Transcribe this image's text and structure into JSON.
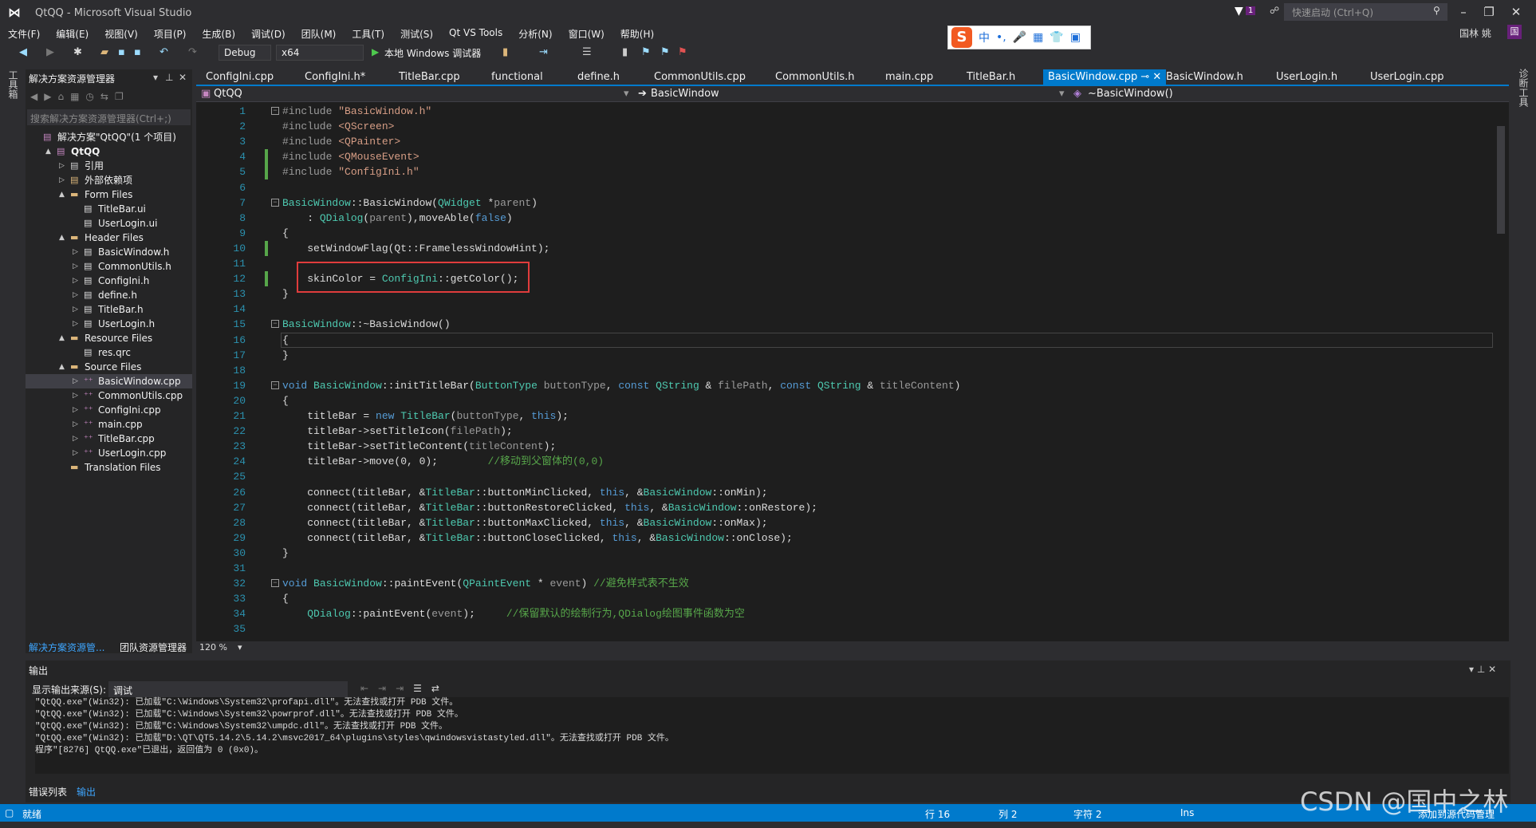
{
  "window": {
    "title": "QtQQ - Microsoft Visual Studio",
    "quick_launch": "快速启动 (Ctrl+Q)",
    "notif_count": "1",
    "user": "国林 姚",
    "avatar": "国"
  },
  "menu": [
    "文件(F)",
    "编辑(E)",
    "视图(V)",
    "项目(P)",
    "生成(B)",
    "调试(D)",
    "团队(M)",
    "工具(T)",
    "测试(S)",
    "Qt VS Tools",
    "分析(N)",
    "窗口(W)",
    "帮助(H)"
  ],
  "toolbar": {
    "config": "Debug",
    "platform": "x64",
    "run": "本地 Windows 调试器"
  },
  "ime": {
    "items": [
      "中",
      "•,",
      "🎤",
      "▦",
      "👕",
      "▣"
    ]
  },
  "left_strip": "工具箱",
  "right_strip": "诊断工具",
  "solution_explorer": {
    "title": "解决方案资源管理器",
    "search_placeholder": "搜索解决方案资源管理器(Ctrl+;)",
    "items": [
      {
        "label": "解决方案\"QtQQ\"(1 个项目)",
        "level": 0,
        "arrow": "",
        "icon": "solution"
      },
      {
        "label": "QtQQ",
        "level": 1,
        "arrow": "▲",
        "icon": "project",
        "bold": true
      },
      {
        "label": "引用",
        "level": 2,
        "arrow": "▷",
        "icon": "references"
      },
      {
        "label": "外部依赖项",
        "level": 2,
        "arrow": "▷",
        "icon": "dependencies"
      },
      {
        "label": "Form Files",
        "level": 2,
        "arrow": "▲",
        "icon": "folder"
      },
      {
        "label": "TitleBar.ui",
        "level": 3,
        "arrow": "",
        "icon": "file"
      },
      {
        "label": "UserLogin.ui",
        "level": 3,
        "arrow": "",
        "icon": "file"
      },
      {
        "label": "Header Files",
        "level": 2,
        "arrow": "▲",
        "icon": "folder"
      },
      {
        "label": "BasicWindow.h",
        "level": 3,
        "arrow": "▷",
        "icon": "header"
      },
      {
        "label": "CommonUtils.h",
        "level": 3,
        "arrow": "▷",
        "icon": "header"
      },
      {
        "label": "ConfigIni.h",
        "level": 3,
        "arrow": "▷",
        "icon": "header"
      },
      {
        "label": "define.h",
        "level": 3,
        "arrow": "▷",
        "icon": "header"
      },
      {
        "label": "TitleBar.h",
        "level": 3,
        "arrow": "▷",
        "icon": "header"
      },
      {
        "label": "UserLogin.h",
        "level": 3,
        "arrow": "▷",
        "icon": "header"
      },
      {
        "label": "Resource Files",
        "level": 2,
        "arrow": "▲",
        "icon": "folder"
      },
      {
        "label": "res.qrc",
        "level": 3,
        "arrow": "",
        "icon": "file"
      },
      {
        "label": "Source Files",
        "level": 2,
        "arrow": "▲",
        "icon": "folder"
      },
      {
        "label": "BasicWindow.cpp",
        "level": 3,
        "arrow": "▷",
        "icon": "cpp",
        "selected": true
      },
      {
        "label": "CommonUtils.cpp",
        "level": 3,
        "arrow": "▷",
        "icon": "cpp"
      },
      {
        "label": "ConfigIni.cpp",
        "level": 3,
        "arrow": "▷",
        "icon": "cpp"
      },
      {
        "label": "main.cpp",
        "level": 3,
        "arrow": "▷",
        "icon": "cpp"
      },
      {
        "label": "TitleBar.cpp",
        "level": 3,
        "arrow": "▷",
        "icon": "cpp"
      },
      {
        "label": "UserLogin.cpp",
        "level": 3,
        "arrow": "▷",
        "icon": "cpp"
      },
      {
        "label": "Translation Files",
        "level": 2,
        "arrow": "",
        "icon": "folder"
      }
    ],
    "bottom_tabs": [
      "解决方案资源管...",
      "团队资源管理器"
    ]
  },
  "editor": {
    "tabs": [
      {
        "label": "ConfigIni.cpp"
      },
      {
        "label": "ConfigIni.h*"
      },
      {
        "label": "TitleBar.cpp"
      },
      {
        "label": "functional"
      },
      {
        "label": "define.h"
      },
      {
        "label": "CommonUtils.cpp"
      },
      {
        "label": "CommonUtils.h"
      },
      {
        "label": "main.cpp"
      },
      {
        "label": "TitleBar.h"
      },
      {
        "label": "BasicWindow.cpp",
        "active": true
      },
      {
        "label": "BasicWindow.h"
      },
      {
        "label": "UserLogin.h"
      },
      {
        "label": "UserLogin.cpp"
      }
    ],
    "nav": {
      "project": "QtQQ",
      "class": "BasicWindow",
      "member": "~BasicWindow()"
    },
    "zoom": "120 %",
    "lines": [
      [
        [
          "#include ",
          "p"
        ],
        [
          "\"BasicWindow.h\"",
          "s"
        ]
      ],
      [
        [
          "#include ",
          "p"
        ],
        [
          "<QScreen>",
          "s"
        ]
      ],
      [
        [
          "#include ",
          "p"
        ],
        [
          "<QPainter>",
          "s"
        ]
      ],
      [
        [
          "#include ",
          "p"
        ],
        [
          "<QMouseEvent>",
          "s"
        ]
      ],
      [
        [
          "#include ",
          "p"
        ],
        [
          "\"ConfigIni.h\"",
          "s"
        ]
      ],
      [],
      [
        [
          "BasicWindow",
          "t"
        ],
        [
          "::BasicWindow(",
          "n"
        ],
        [
          "QWidget",
          "t"
        ],
        [
          " *",
          "n"
        ],
        [
          "parent",
          "v"
        ],
        [
          ")",
          "n"
        ]
      ],
      [
        [
          "    : ",
          "n"
        ],
        [
          "QDialog",
          "t"
        ],
        [
          "(",
          "n"
        ],
        [
          "parent",
          "v"
        ],
        [
          "),moveAble(",
          "n"
        ],
        [
          "false",
          "k"
        ],
        [
          ")",
          "n"
        ]
      ],
      [
        [
          "{",
          "n"
        ]
      ],
      [
        [
          "    setWindowFlag(Qt::FramelessWindowHint);",
          "n"
        ]
      ],
      [],
      [
        [
          "    skinColor = ",
          "n"
        ],
        [
          "ConfigIni",
          "t"
        ],
        [
          "::getColor();",
          "n"
        ]
      ],
      [
        [
          "}",
          "n"
        ]
      ],
      [],
      [
        [
          "BasicWindow",
          "t"
        ],
        [
          "::~BasicWindow()",
          "n"
        ]
      ],
      [
        [
          "{",
          "n"
        ]
      ],
      [
        [
          "}",
          "n"
        ]
      ],
      [],
      [
        [
          "void ",
          "k"
        ],
        [
          "BasicWindow",
          "t"
        ],
        [
          "::initTitleBar(",
          "n"
        ],
        [
          "ButtonType ",
          "t"
        ],
        [
          "buttonType",
          "v"
        ],
        [
          ", ",
          "n"
        ],
        [
          "const ",
          "k"
        ],
        [
          "QString",
          "t"
        ],
        [
          " & ",
          "n"
        ],
        [
          "filePath",
          "v"
        ],
        [
          ", ",
          "n"
        ],
        [
          "const ",
          "k"
        ],
        [
          "QString",
          "t"
        ],
        [
          " & ",
          "n"
        ],
        [
          "titleContent",
          "v"
        ],
        [
          ")",
          "n"
        ]
      ],
      [
        [
          "{",
          "n"
        ]
      ],
      [
        [
          "    titleBar = ",
          "n"
        ],
        [
          "new ",
          "k"
        ],
        [
          "TitleBar",
          "t"
        ],
        [
          "(",
          "n"
        ],
        [
          "buttonType",
          "v"
        ],
        [
          ", ",
          "n"
        ],
        [
          "this",
          "k"
        ],
        [
          ");",
          "n"
        ]
      ],
      [
        [
          "    titleBar->setTitleIcon(",
          "n"
        ],
        [
          "filePath",
          "v"
        ],
        [
          ");",
          "n"
        ]
      ],
      [
        [
          "    titleBar->setTitleContent(",
          "n"
        ],
        [
          "titleContent",
          "v"
        ],
        [
          ");",
          "n"
        ]
      ],
      [
        [
          "    titleBar->move(0, 0);        ",
          "n"
        ],
        [
          "//移动到父窗体的(0,0)",
          "c"
        ]
      ],
      [],
      [
        [
          "    connect(titleBar, &",
          "n"
        ],
        [
          "TitleBar",
          "t"
        ],
        [
          "::buttonMinClicked, ",
          "n"
        ],
        [
          "this",
          "k"
        ],
        [
          ", &",
          "n"
        ],
        [
          "BasicWindow",
          "t"
        ],
        [
          "::onMin);",
          "n"
        ]
      ],
      [
        [
          "    connect(titleBar, &",
          "n"
        ],
        [
          "TitleBar",
          "t"
        ],
        [
          "::buttonRestoreClicked, ",
          "n"
        ],
        [
          "this",
          "k"
        ],
        [
          ", &",
          "n"
        ],
        [
          "BasicWindow",
          "t"
        ],
        [
          "::onRestore);",
          "n"
        ]
      ],
      [
        [
          "    connect(titleBar, &",
          "n"
        ],
        [
          "TitleBar",
          "t"
        ],
        [
          "::buttonMaxClicked, ",
          "n"
        ],
        [
          "this",
          "k"
        ],
        [
          ", &",
          "n"
        ],
        [
          "BasicWindow",
          "t"
        ],
        [
          "::onMax);",
          "n"
        ]
      ],
      [
        [
          "    connect(titleBar, &",
          "n"
        ],
        [
          "TitleBar",
          "t"
        ],
        [
          "::buttonCloseClicked, ",
          "n"
        ],
        [
          "this",
          "k"
        ],
        [
          ", &",
          "n"
        ],
        [
          "BasicWindow",
          "t"
        ],
        [
          "::onClose);",
          "n"
        ]
      ],
      [
        [
          "}",
          "n"
        ]
      ],
      [],
      [
        [
          "void ",
          "k"
        ],
        [
          "BasicWindow",
          "t"
        ],
        [
          "::paintEvent(",
          "n"
        ],
        [
          "QPaintEvent",
          "t"
        ],
        [
          " * ",
          "n"
        ],
        [
          "event",
          "v"
        ],
        [
          ") ",
          "n"
        ],
        [
          "//避免样式表不生效",
          "c"
        ]
      ],
      [
        [
          "{",
          "n"
        ]
      ],
      [
        [
          "    ",
          "n"
        ],
        [
          "QDialog",
          "t"
        ],
        [
          "::paintEvent(",
          "n"
        ],
        [
          "event",
          "v"
        ],
        [
          ");     ",
          "n"
        ],
        [
          "//保留默认的绘制行为,QDialog绘图事件函数为空",
          "c"
        ]
      ],
      []
    ]
  },
  "output": {
    "title": "输出",
    "source_label": "显示输出来源(S):",
    "source_value": "调试",
    "lines": [
      "\"QtQQ.exe\"(Win32): 已加载\"C:\\Windows\\System32\\profapi.dll\"。无法查找或打开 PDB 文件。",
      "\"QtQQ.exe\"(Win32): 已加载\"C:\\Windows\\System32\\powrprof.dll\"。无法查找或打开 PDB 文件。",
      "\"QtQQ.exe\"(Win32): 已加载\"C:\\Windows\\System32\\umpdc.dll\"。无法查找或打开 PDB 文件。",
      "\"QtQQ.exe\"(Win32): 已加载\"D:\\QT\\QT5.14.2\\5.14.2\\msvc2017_64\\plugins\\styles\\qwindowsvistastyled.dll\"。无法查找或打开 PDB 文件。",
      "程序\"[8276] QtQQ.exe\"已退出，返回值为 0 (0x0)。"
    ],
    "bottom_tabs": [
      "错误列表",
      "输出"
    ]
  },
  "status": {
    "ready": "就绪",
    "row": "行 16",
    "col": "列 2",
    "char": "字符 2",
    "mode": "Ins",
    "source_control": "添加到源代码管理"
  },
  "watermark": "CSDN @国中之林",
  "colors": {
    "accent": "#007acc",
    "background": "#1e1e1e",
    "highlight_box": "#e03c3c"
  }
}
